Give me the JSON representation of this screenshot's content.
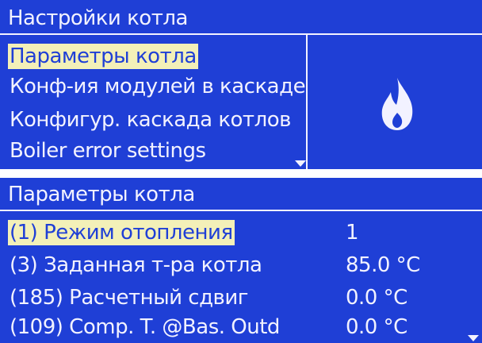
{
  "screen1": {
    "title": "Настройки котла",
    "items": [
      {
        "label": "Параметры котла",
        "selected": true
      },
      {
        "label": "Конф-ия модулей в каскаде",
        "selected": false
      },
      {
        "label": "Конфигур. каскада котлов",
        "selected": false
      },
      {
        "label": "Boiler error settings",
        "selected": false
      }
    ],
    "icon": "flame-icon"
  },
  "screen2": {
    "title": "Параметры котла",
    "rows": [
      {
        "label": "(1) Режим отопления",
        "value": "1",
        "selected": true
      },
      {
        "label": "(3) Заданная т-ра котла",
        "value": "85.0 °C",
        "selected": false
      },
      {
        "label": "(185) Расчетный сдвиг",
        "value": "0.0 °C",
        "selected": false
      },
      {
        "label": "(109) Comp. T. @Bas. Outd",
        "value": "0.0 °C",
        "selected": false
      }
    ]
  },
  "colors": {
    "background": "#1f3fd6",
    "text": "#f2f2ff",
    "highlight": "#f3f0b8"
  }
}
